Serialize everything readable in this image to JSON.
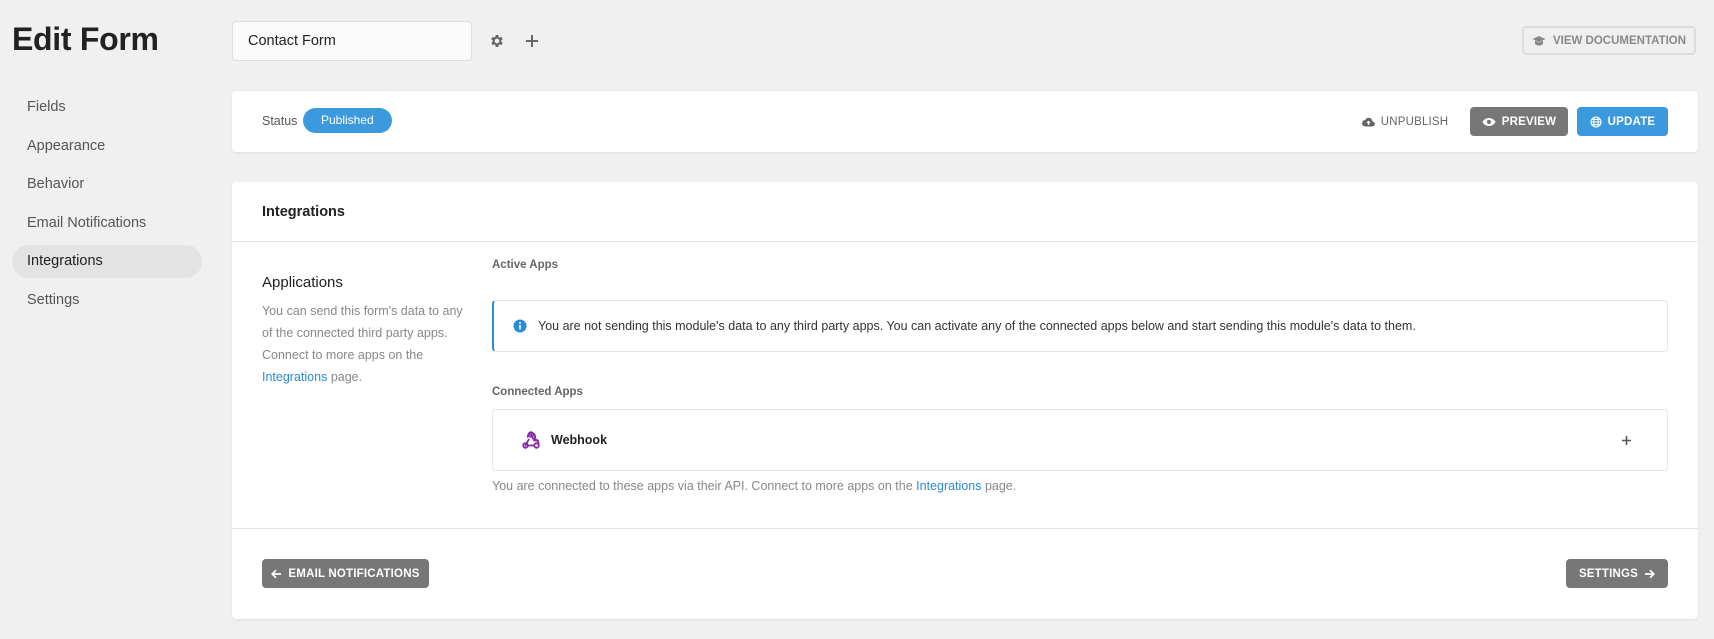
{
  "page": {
    "title": "Edit Form"
  },
  "sidebar": {
    "items": [
      {
        "label": "Fields"
      },
      {
        "label": "Appearance"
      },
      {
        "label": "Behavior"
      },
      {
        "label": "Email Notifications"
      },
      {
        "label": "Integrations",
        "active": true
      },
      {
        "label": "Settings"
      }
    ]
  },
  "header": {
    "form_name": "Contact Form",
    "doc_label": "VIEW DOCUMENTATION"
  },
  "status": {
    "label": "Status",
    "badge": "Published",
    "unpublish_label": "UNPUBLISH",
    "preview_label": "PREVIEW",
    "update_label": "UPDATE"
  },
  "integrations": {
    "title": "Integrations",
    "applications_title": "Applications",
    "applications_desc": "You can send this form's data to any of the connected third party apps. Connect to more apps on the",
    "applications_link": "Integrations",
    "applications_suffix": "page.",
    "active_label": "Active Apps",
    "active_notice": "You are not sending this module's data to any third party apps. You can activate any of the connected apps below and start sending this module's data to them.",
    "connected_label": "Connected Apps",
    "apps": [
      {
        "name": "Webhook",
        "icon": "webhook-icon"
      }
    ],
    "connected_note": "You are connected to these apps via their API. Connect to more apps on the",
    "connected_link": "Integrations",
    "connected_suffix": "page."
  },
  "footer": {
    "prev_label": "EMAIL NOTIFICATIONS",
    "next_label": "SETTINGS"
  },
  "colors": {
    "accent": "#3b99de",
    "link": "#2a8bd6",
    "secondary_button": "#777777",
    "webhook_icon": "#8b2aa8"
  }
}
